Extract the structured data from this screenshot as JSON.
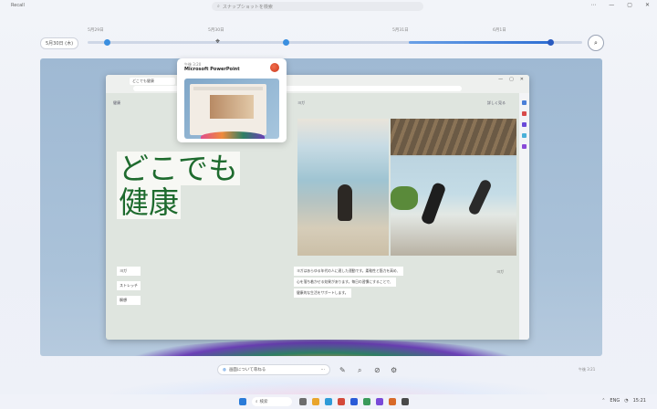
{
  "titlebar": {
    "app_title": "Recall",
    "search_placeholder": "スナップショットを検索",
    "controls": [
      "⋯",
      "—",
      "▢",
      "✕"
    ]
  },
  "timeline": {
    "date_label": "5月30日 (木)",
    "ticks": [
      "5月29日",
      "5月30日",
      "5月31日",
      "6月1日"
    ],
    "zoom_icon": "search-icon"
  },
  "browser": {
    "tab_title": "どこでも健康",
    "page": {
      "brand": "健康",
      "nav1": "ヨガ",
      "nav2": "詳しく見る",
      "headline_lines": [
        "どこでも",
        "健康"
      ],
      "menu": [
        "ヨガ",
        "ストレッチ",
        "瞑想"
      ],
      "body_lines": [
        "ヨガはあらゆる年代の人に適した運動です。柔軟性と筋力を高め、",
        "心を落ち着かせる効果があります。毎日の習慣にすることで、",
        "健康的な生活をサポートします。"
      ],
      "side_note": "ヨガ"
    }
  },
  "preview": {
    "time": "午後 3:20",
    "title": "Microsoft PowerPoint"
  },
  "ask_bar": {
    "label": "画面について尋ねる",
    "more": "⋯",
    "tools": [
      "✎",
      "⌕",
      "⊘",
      "⚙"
    ]
  },
  "snapshot_time": "午後 3:21",
  "taskbar": {
    "search_label": "検索",
    "tray": [
      "ENG",
      "15:21"
    ]
  },
  "colors": {
    "accent": "#2f6fd3",
    "headline": "#1e6b2e"
  }
}
